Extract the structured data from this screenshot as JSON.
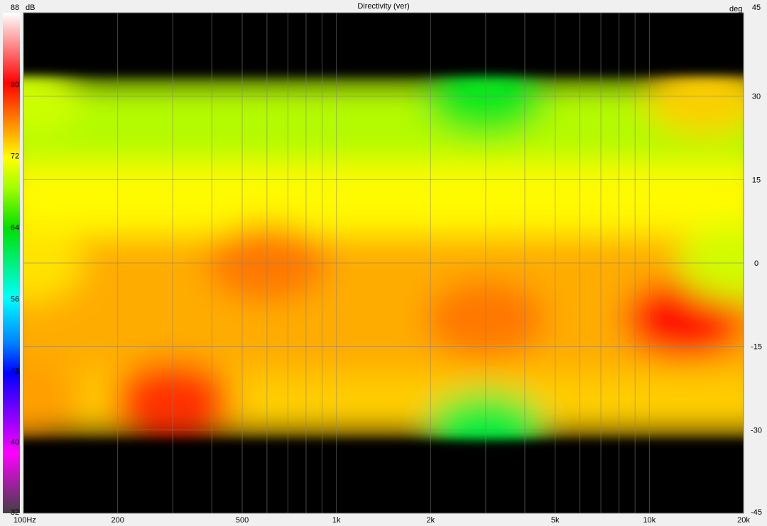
{
  "chart_data": {
    "type": "heatmap",
    "title": "Directivity (ver)",
    "xlabel": "",
    "ylabel": "",
    "x_scale": "log",
    "x_range": [
      100,
      20000
    ],
    "x_tick_labels": [
      {
        "value": 100,
        "label": "100Hz"
      },
      {
        "value": 200,
        "label": "200"
      },
      {
        "value": 500,
        "label": "500"
      },
      {
        "value": 1000,
        "label": "1k"
      },
      {
        "value": 2000,
        "label": "2k"
      },
      {
        "value": 5000,
        "label": "5k"
      },
      {
        "value": 10000,
        "label": "10k"
      },
      {
        "value": 20000,
        "label": "20k"
      }
    ],
    "y_unit": "deg",
    "y_range": [
      -45,
      45
    ],
    "y_ticks": [
      45,
      30,
      15,
      0,
      -15,
      -30,
      -45
    ],
    "colorbar_unit": "dB",
    "colorbar_range": [
      32,
      88
    ],
    "colorbar_ticks": [
      88,
      80,
      72,
      64,
      56,
      48,
      40,
      32
    ],
    "grid": true,
    "measured_angle_range": [
      -31,
      33
    ],
    "z_description_points": [
      {
        "freq": 100,
        "angle": 30,
        "db": 70
      },
      {
        "freq": 100,
        "angle": 0,
        "db": 73
      },
      {
        "freq": 100,
        "angle": -25,
        "db": 76
      },
      {
        "freq": 300,
        "angle": -25,
        "db": 79
      },
      {
        "freq": 600,
        "angle": 0,
        "db": 77
      },
      {
        "freq": 3000,
        "angle": 30,
        "db": 63
      },
      {
        "freq": 3000,
        "angle": -30,
        "db": 62
      },
      {
        "freq": 3000,
        "angle": -10,
        "db": 77
      },
      {
        "freq": 13000,
        "angle": -10,
        "db": 80
      },
      {
        "freq": 15000,
        "angle": 30,
        "db": 74
      },
      {
        "freq": 19000,
        "angle": 0,
        "db": 70
      }
    ]
  }
}
